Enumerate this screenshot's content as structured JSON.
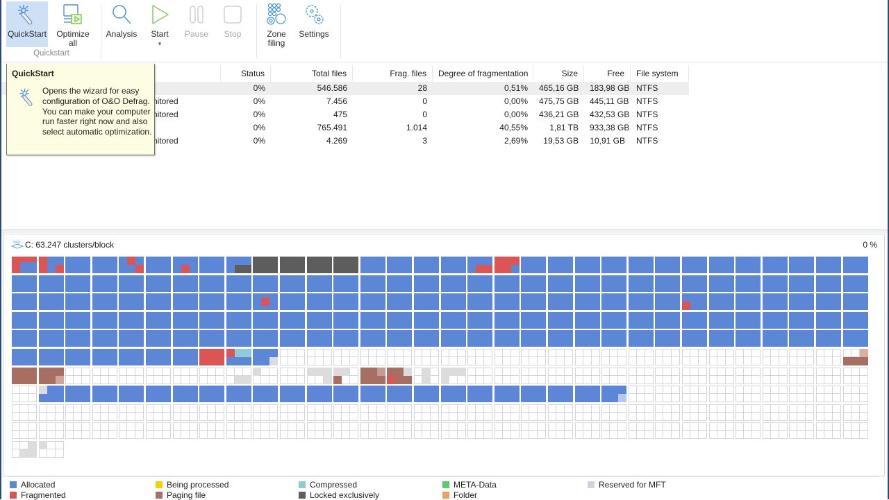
{
  "ribbon": {
    "buttons": [
      {
        "id": "quickstart",
        "label": "QuickStart",
        "icon": "wand-icon",
        "state": "active"
      },
      {
        "id": "optimize-all",
        "label": "Optimize all",
        "icon": "monitor-play-icon",
        "state": "normal"
      },
      {
        "id": "analysis",
        "label": "Analysis",
        "icon": "magnifier-icon",
        "state": "normal"
      },
      {
        "id": "start",
        "label": "Start",
        "icon": "play-icon",
        "state": "normal",
        "has_dropdown": true
      },
      {
        "id": "pause",
        "label": "Pause",
        "icon": "pause-icon",
        "state": "disabled"
      },
      {
        "id": "stop",
        "label": "Stop",
        "icon": "stop-icon",
        "state": "disabled"
      },
      {
        "id": "zone-filing",
        "label": "Zone filing",
        "icon": "zone-filing-icon",
        "state": "normal"
      },
      {
        "id": "settings",
        "label": "Settings",
        "icon": "gears-icon",
        "state": "normal"
      }
    ],
    "optimize_line1": "Optimize",
    "optimize_line2": "all",
    "zone_line1": "Zone",
    "zone_line2": "filing",
    "start_dropdown_glyph": "▾",
    "group_label": "Quickstart"
  },
  "tooltip": {
    "title": "QuickStart",
    "body": "Opens the wizard for easy configuration of O&O Defrag. You can make your computer run faster right now and also select automatic optimization."
  },
  "volumes": {
    "columns": [
      "",
      "Status",
      "Total files",
      "Frag. files",
      "Degree of fragmentation",
      "Size",
      "Free",
      "File system"
    ],
    "rows": [
      {
        "name": "",
        "status": "0%",
        "total_files": "546.586",
        "frag_files": "28",
        "degree": "0,51%",
        "size": "465,16 GB",
        "free": "183,98 GB",
        "fs": "NTFS",
        "selected": true
      },
      {
        "name": "nitored",
        "status": "0%",
        "total_files": "7.456",
        "frag_files": "0",
        "degree": "0,00%",
        "size": "475,75 GB",
        "free": "445,11 GB",
        "fs": "NTFS",
        "selected": false
      },
      {
        "name": "nitored",
        "status": "0%",
        "total_files": "475",
        "frag_files": "0",
        "degree": "0,00%",
        "size": "436,21 GB",
        "free": "432,53 GB",
        "fs": "NTFS",
        "selected": false
      },
      {
        "name": "",
        "status": "0%",
        "total_files": "765.491",
        "frag_files": "1.014",
        "degree": "40,55%",
        "size": "1,81 TB",
        "free": "933,38 GB",
        "fs": "NTFS",
        "selected": false
      },
      {
        "name": "nitored",
        "status": "0%",
        "total_files": "4.269",
        "frag_files": "3",
        "degree": "2,69%",
        "size": "19,53 GB",
        "free": "10,91 GB",
        "fs": "NTFS",
        "selected": false
      }
    ]
  },
  "blockmap": {
    "drive_label": "C: 63.247 clusters/block",
    "drive_icon": "ssd-icon",
    "progress": "0 %",
    "columns_per_row": 32,
    "rows": [
      "ffAAfAAAfLLLLAAAAfAAAAAAAAAAAAAAAA",
      "AAAAAAAAAAAAAAAAAAAAAAAAAAAAAAAA",
      "AAAAAAAAAfAAAAAAAAAAAAAAAAfAAAAA",
      "AAAAAAAAAAAAAAAAAAAAAAAAAAAAAAAA",
      "AAAAAAAAAAAAAAAAAAAAAAAAAAAAAAAA",
      "AAAAAAARcAEEEEEEEEEEEEEEEEEEEEEp",
      "PPEEEEEEEEEEEPPEEEEEEEEEEEEEEEEE",
      "EAAAAAAAAAAAAAAAAAAAAAAEEEEEEEEE",
      "EEEEEEEEEEEEEEEEEEEEEEEEEEEEEEEE",
      "EEEEEEEEEEEEEEEEEEEEEEEEEEEEEEEE",
      "EE"
    ],
    "block_types": {
      "A": "allocated",
      "f": "allocated-with-fragments",
      "R": "fragmented",
      "L": "locked-exclusively",
      "P": "paging-file",
      "p": "paging-file-partial",
      "c": "compressed-partial",
      "E": "free"
    }
  },
  "legend": [
    {
      "label": "Allocated",
      "color": "#5b87d6"
    },
    {
      "label": "Fragmented",
      "color": "#dc5454"
    },
    {
      "label": "Being processed",
      "color": "#f2d200"
    },
    {
      "label": "Paging file",
      "color": "#a86e62"
    },
    {
      "label": "Compressed",
      "color": "#8ecad8"
    },
    {
      "label": "Locked exclusively",
      "color": "#5d5d5d"
    },
    {
      "label": "META-Data",
      "color": "#5ccc6a"
    },
    {
      "label": "Folder",
      "color": "#f0a058"
    },
    {
      "label": "Reserved for MFT",
      "color": "#d4d0e0"
    }
  ],
  "colors": {
    "allocated": "#5b87d6",
    "fragmented": "#dc5454",
    "paging": "#a86e62",
    "compressed": "#8ecad8",
    "locked": "#5d5d5d",
    "free_light": "#dcdcdc",
    "ribbon_active": "#cde0f5",
    "tooltip_bg": "#fdfde3"
  }
}
